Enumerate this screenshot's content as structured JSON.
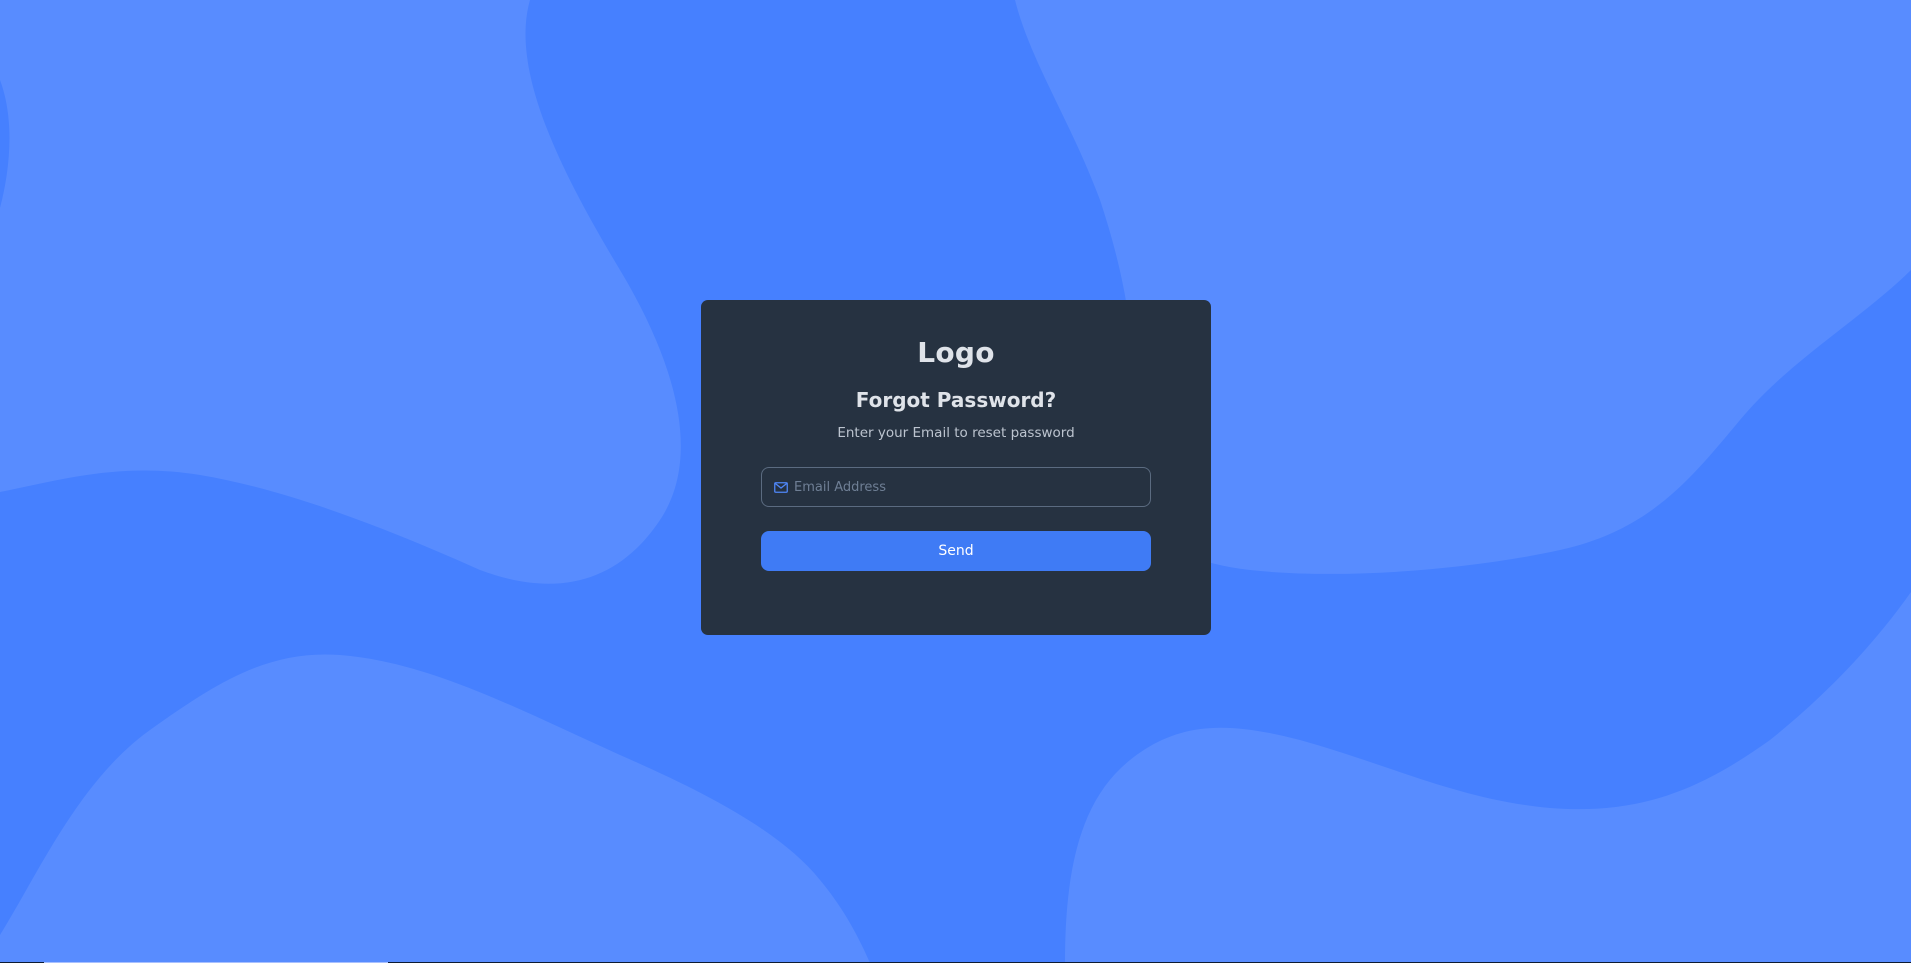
{
  "colors": {
    "background": "#4680ff",
    "background_shape": "#5a8dff",
    "card": "#263241",
    "primary_button": "#3f7bf5"
  },
  "card": {
    "logo_text": "Logo",
    "title": "Forgot Password?",
    "subtitle": "Enter your Email to reset password",
    "email_field": {
      "icon": "mail-icon",
      "placeholder": "Email Address",
      "value": ""
    },
    "send_label": "Send"
  }
}
